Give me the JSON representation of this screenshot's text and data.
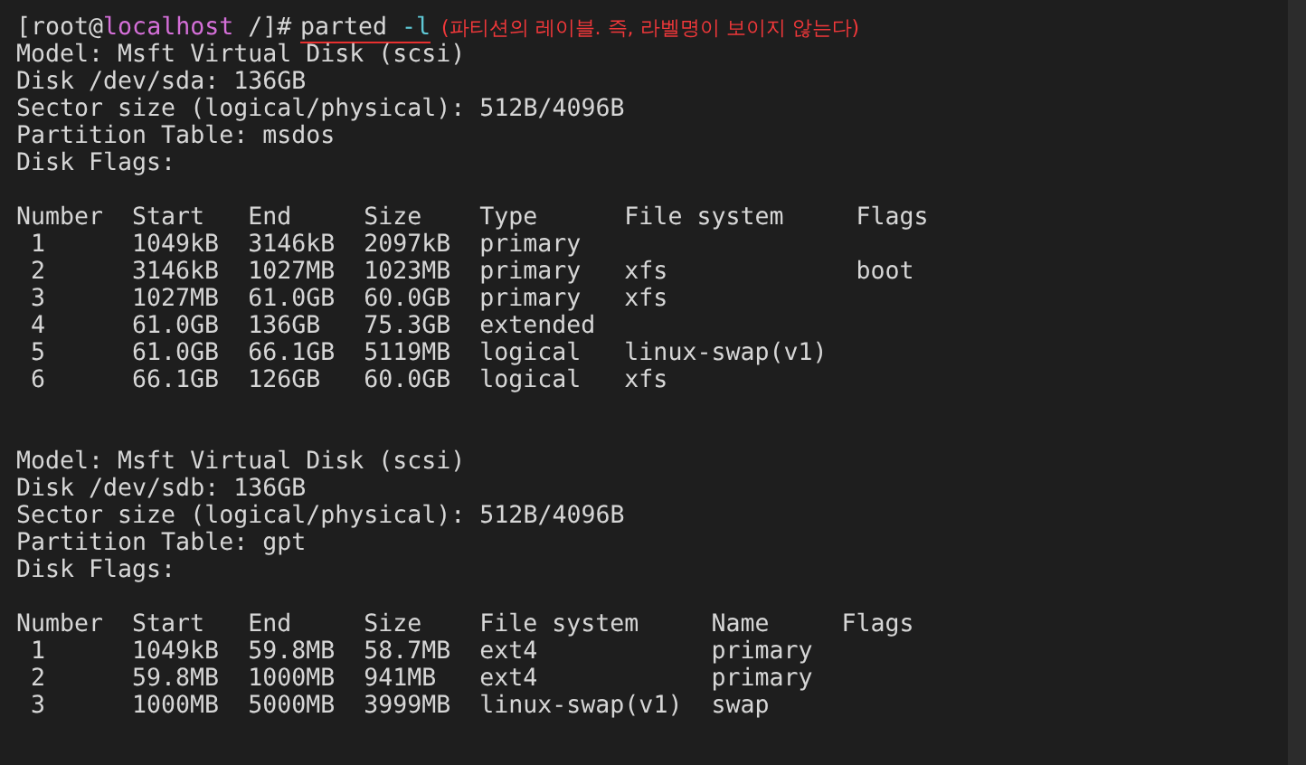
{
  "prompt": {
    "user": "[root@",
    "host": "localhost",
    "path": " /]#",
    "command": "parted",
    "option": "-l",
    "annotation": "(파티션의 레이블. 즉, 라벨명이 보이지 않는다)"
  },
  "disks": [
    {
      "info_lines": [
        "Model: Msft Virtual Disk (scsi)",
        "Disk /dev/sda: 136GB",
        "Sector size (logical/physical): 512B/4096B",
        "Partition Table: msdos",
        "Disk Flags:"
      ],
      "table": {
        "columns": [
          "Number",
          "Start",
          "End",
          "Size",
          "Type",
          "File system",
          "Flags"
        ],
        "rows": [
          [
            "1",
            "1049kB",
            "3146kB",
            "2097kB",
            "primary",
            "",
            ""
          ],
          [
            "2",
            "3146kB",
            "1027MB",
            "1023MB",
            "primary",
            "xfs",
            "boot"
          ],
          [
            "3",
            "1027MB",
            "61.0GB",
            "60.0GB",
            "primary",
            "xfs",
            ""
          ],
          [
            "4",
            "61.0GB",
            "136GB",
            "75.3GB",
            "extended",
            "",
            ""
          ],
          [
            "5",
            "61.0GB",
            "66.1GB",
            "5119MB",
            "logical",
            "linux-swap(v1)",
            ""
          ],
          [
            "6",
            "66.1GB",
            "126GB",
            "60.0GB",
            "logical",
            "xfs",
            ""
          ]
        ]
      }
    },
    {
      "info_lines": [
        "Model: Msft Virtual Disk (scsi)",
        "Disk /dev/sdb: 136GB",
        "Sector size (logical/physical): 512B/4096B",
        "Partition Table: gpt",
        "Disk Flags:"
      ],
      "table": {
        "columns": [
          "Number",
          "Start",
          "End",
          "Size",
          "File system",
          "Name",
          "Flags"
        ],
        "rows": [
          [
            "1",
            "1049kB",
            "59.8MB",
            "58.7MB",
            "ext4",
            "primary",
            ""
          ],
          [
            "2",
            "59.8MB",
            "1000MB",
            "941MB",
            "ext4",
            "primary",
            ""
          ],
          [
            "3",
            "1000MB",
            "5000MB",
            "3999MB",
            "linux-swap(v1)",
            "swap",
            ""
          ]
        ]
      }
    }
  ]
}
